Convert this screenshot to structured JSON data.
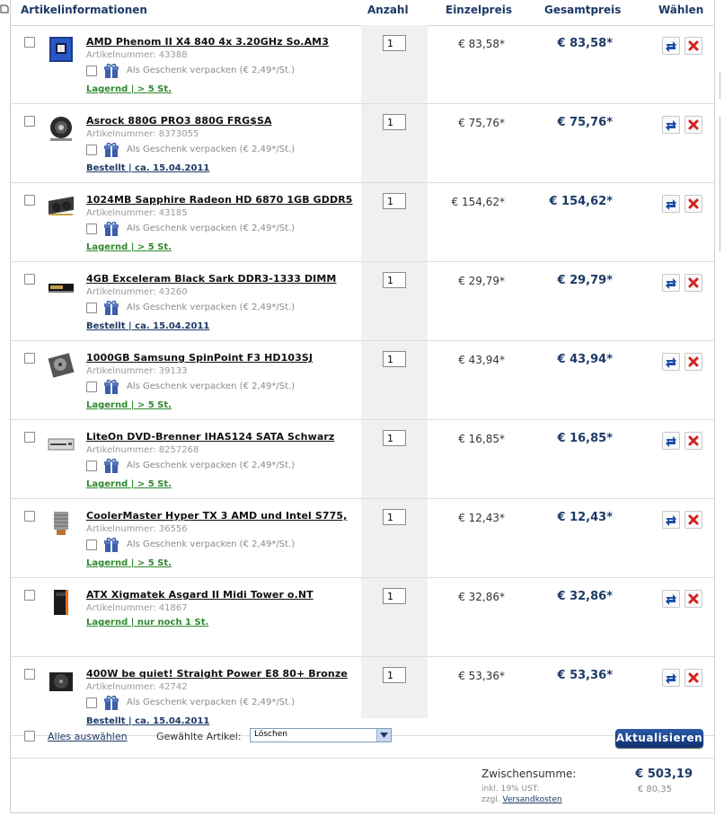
{
  "header": {
    "col_info": "Artikelinformationen",
    "col_qty": "Anzahl",
    "col_unit": "Einzelpreis",
    "col_total": "Gesamtpreis",
    "col_select": "Wählen"
  },
  "gift_label": "Als Geschenk verpacken (€ 2,49*/St.)",
  "items": [
    {
      "name": "AMD Phenom II X4 840 4x 3.20GHz So.AM3",
      "artnr": "Artikelnummer: 43388",
      "gift": true,
      "stock": "Lagernd | > 5 St.",
      "stock_type": "green",
      "qty": "1",
      "unit": "€ 83,58*",
      "total": "€ 83,58*",
      "icon": "cpu-box-icon"
    },
    {
      "name": "Asrock 880G PRO3 880G FRG$SA",
      "artnr": "Artikelnummer: 8373055",
      "gift": true,
      "stock": "Bestellt | ca. 15.04.2011",
      "stock_type": "blue",
      "qty": "1",
      "unit": "€ 75,76*",
      "total": "€ 75,76*",
      "icon": "motherboard-icon"
    },
    {
      "name": "1024MB Sapphire Radeon HD 6870 1GB GDDR5",
      "artnr": "Artikelnummer: 43185",
      "gift": true,
      "stock": "Lagernd | > 5 St.",
      "stock_type": "green",
      "qty": "1",
      "unit": "€ 154,62*",
      "total": "€ 154,62*",
      "icon": "graphics-card-icon"
    },
    {
      "name": "4GB Exceleram Black Sark DDR3-1333 DIMM",
      "artnr": "Artikelnummer: 43260",
      "gift": true,
      "stock": "Bestellt | ca. 15.04.2011",
      "stock_type": "blue",
      "qty": "1",
      "unit": "€ 29,79*",
      "total": "€ 29,79*",
      "icon": "ram-module-icon"
    },
    {
      "name": "1000GB Samsung SpinPoint F3 HD103SJ",
      "artnr": "Artikelnummer: 39133",
      "gift": true,
      "stock": "Lagernd | > 5 St.",
      "stock_type": "green",
      "qty": "1",
      "unit": "€ 43,94*",
      "total": "€ 43,94*",
      "icon": "hard-drive-icon"
    },
    {
      "name": "LiteOn DVD-Brenner IHAS124 SATA Schwarz",
      "artnr": "Artikelnummer: 8257268",
      "gift": true,
      "stock": "Lagernd | > 5 St.",
      "stock_type": "green",
      "qty": "1",
      "unit": "€ 16,85*",
      "total": "€ 16,85*",
      "icon": "dvd-drive-icon"
    },
    {
      "name": "CoolerMaster Hyper TX 3 AMD und Intel S775,",
      "artnr": "Artikelnummer: 36556",
      "gift": true,
      "stock": "Lagernd | > 5 St.",
      "stock_type": "green",
      "qty": "1",
      "unit": "€ 12,43*",
      "total": "€ 12,43*",
      "icon": "cpu-cooler-icon"
    },
    {
      "name": "ATX Xigmatek Asgard II Midi Tower o.NT",
      "artnr": "Artikelnummer: 41867",
      "gift": false,
      "stock": "Lagernd | nur noch 1 St.",
      "stock_type": "green",
      "qty": "1",
      "unit": "€ 32,86*",
      "total": "€ 32,86*",
      "icon": "pc-tower-icon"
    },
    {
      "name": "400W be quiet! Straight Power E8 80+ Bronze",
      "artnr": "Artikelnummer: 42742",
      "gift": true,
      "stock": "Bestellt | ca. 15.04.2011",
      "stock_type": "blue",
      "qty": "1",
      "unit": "€ 53,36*",
      "total": "€ 53,36*",
      "icon": "power-supply-icon"
    }
  ],
  "footer": {
    "select_all": "Alles auswählen",
    "selected_label": "Gewählte Artikel:",
    "action_value": "Löschen",
    "update_button": "Aktualisieren"
  },
  "summary": {
    "subtotal_label": "Zwischensumme:",
    "subtotal_value": "€ 503,19",
    "tax_label": "inkl. 19% UST:",
    "tax_value": "€ 80,35",
    "shipping_prefix": "zzgl.",
    "shipping_link": "Versandkosten"
  },
  "colors": {
    "accent": "#1d3a66",
    "stock_green": "#2e8a2e",
    "delete_red": "#d42020"
  }
}
